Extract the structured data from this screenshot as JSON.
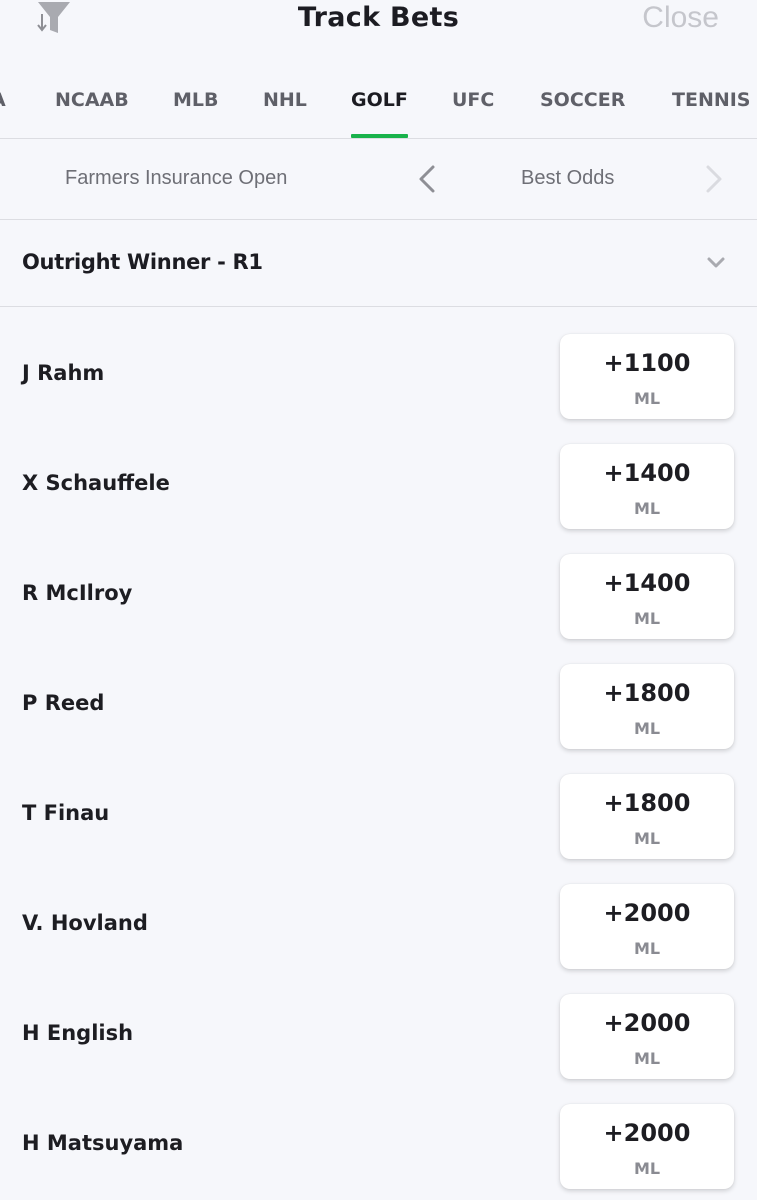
{
  "header": {
    "title": "Track Bets",
    "close_label": "Close",
    "filter_icon": "filter-sort-icon"
  },
  "tabs": [
    {
      "label": "A",
      "active": false
    },
    {
      "label": "NCAAB",
      "active": false
    },
    {
      "label": "MLB",
      "active": false
    },
    {
      "label": "NHL",
      "active": false
    },
    {
      "label": "GOLF",
      "active": true
    },
    {
      "label": "UFC",
      "active": false
    },
    {
      "label": "SOCCER",
      "active": false
    },
    {
      "label": "TENNIS",
      "active": false
    }
  ],
  "event_bar": {
    "event_name": "Farmers Insurance Open",
    "odds_label": "Best Odds"
  },
  "market": {
    "title": "Outright Winner - R1"
  },
  "players": [
    {
      "name": "J Rahm",
      "odds": "+1100",
      "type": "ML"
    },
    {
      "name": "X Schauffele",
      "odds": "+1400",
      "type": "ML"
    },
    {
      "name": "R McIlroy",
      "odds": "+1400",
      "type": "ML"
    },
    {
      "name": "P Reed",
      "odds": "+1800",
      "type": "ML"
    },
    {
      "name": "T Finau",
      "odds": "+1800",
      "type": "ML"
    },
    {
      "name": "V. Hovland",
      "odds": "+2000",
      "type": "ML"
    },
    {
      "name": "H English",
      "odds": "+2000",
      "type": "ML"
    },
    {
      "name": "H Matsuyama",
      "odds": "+2000",
      "type": "ML"
    }
  ],
  "colors": {
    "accent": "#18b24b",
    "background": "#f6f7fb",
    "muted_text": "#6e6f76",
    "close_text": "#c5c6cc"
  }
}
